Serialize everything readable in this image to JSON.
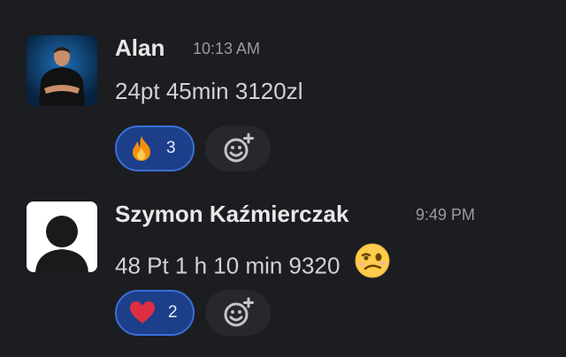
{
  "messages": [
    {
      "author": "Alan",
      "time": "10:13 AM",
      "text": "24pt 45min 3120zl",
      "reaction": {
        "emoji": "fire",
        "count": "3"
      },
      "avatar": "photo"
    },
    {
      "author": "Szymon Kaźmierczak",
      "time": "9:49 PM",
      "text": "48 Pt 1 h 10 min 9320",
      "text_emoji": "woozy-face",
      "reaction": {
        "emoji": "red-heart",
        "count": "2"
      },
      "avatar": "default-user"
    }
  ],
  "colors": {
    "background": "#1b1d21",
    "reaction_bg": "#1d3f8a",
    "reaction_border": "#3b6fd8"
  }
}
